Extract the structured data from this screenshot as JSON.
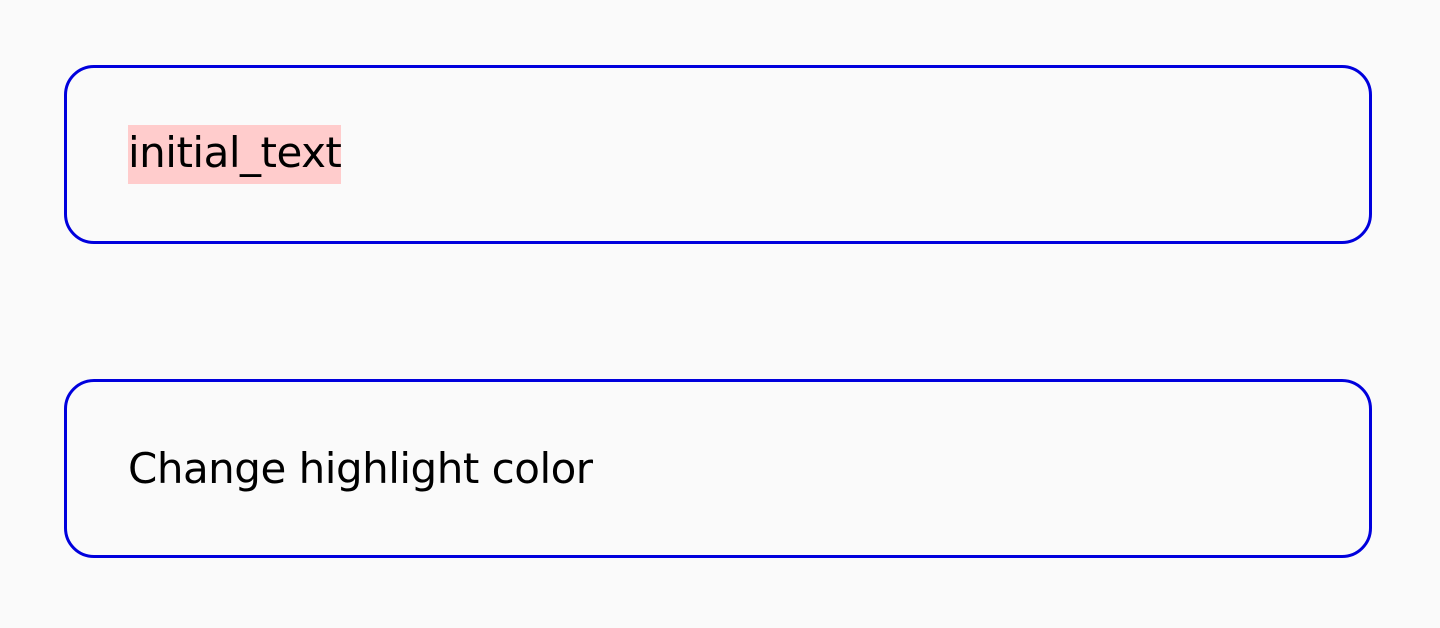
{
  "text_field": {
    "value": "initial_text",
    "highlight_color": "#ffcccc"
  },
  "button": {
    "label": "Change highlight color"
  },
  "colors": {
    "border": "#0000dd",
    "background": "#fafafa",
    "text": "#000000"
  }
}
